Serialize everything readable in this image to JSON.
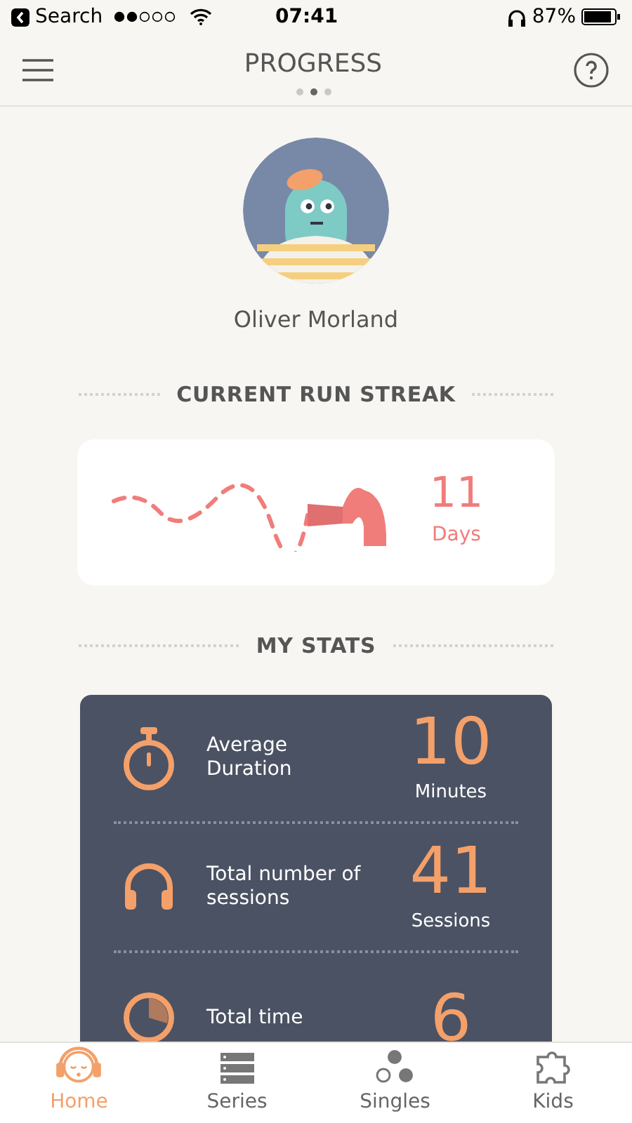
{
  "status_bar": {
    "back_label": "Search",
    "time": "07:41",
    "battery": "87%"
  },
  "header": {
    "title": "PROGRESS",
    "pages": [
      {
        "selected": false
      },
      {
        "selected": true
      },
      {
        "selected": false
      }
    ]
  },
  "profile": {
    "name": "Oliver Morland"
  },
  "streak": {
    "heading": "CURRENT RUN STREAK",
    "value": "11",
    "unit": "Days"
  },
  "stats": {
    "heading": "MY STATS",
    "items": [
      {
        "kind": "timer",
        "label": "Average Duration",
        "value": "10",
        "unit": "Minutes"
      },
      {
        "kind": "headphones",
        "label": "Total number of sessions",
        "value": "41",
        "unit": "Sessions"
      },
      {
        "kind": "pie",
        "label": "Total time",
        "value": "6"
      }
    ]
  },
  "tabs": [
    {
      "kind": "home",
      "label": "Home",
      "selected": true
    },
    {
      "kind": "series",
      "label": "Series",
      "selected": false
    },
    {
      "kind": "singles",
      "label": "Singles",
      "selected": false
    },
    {
      "kind": "kids",
      "label": "Kids",
      "selected": false
    }
  ]
}
